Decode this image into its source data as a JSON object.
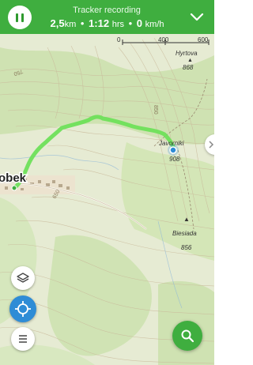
{
  "status_bar": {
    "title": "Tracker recording",
    "distance_value": "2,5",
    "distance_unit": "km",
    "duration_value": "1:12",
    "duration_unit": "hrs",
    "speed_value": "0",
    "speed_unit": "km/h",
    "separator": "•"
  },
  "scale": {
    "start_label": "0",
    "mid_label": "400",
    "end_label": "600"
  },
  "map_labels": {
    "place_left": "obek",
    "peak_javorniki_name": "Javorniki",
    "peak_javorniki_elev": "908",
    "peak_top_name": "Hyrtova",
    "peak_top_elev": "868",
    "peak_biesiada_name": "Biesiada",
    "peak_biesiada_elev": "856",
    "contour_850": "850",
    "contour_750": "750",
    "contour_650": "650"
  },
  "colors": {
    "accent": "#3fae3f",
    "track": "#6ee05a",
    "location": "#2e8cd6"
  },
  "icons": {
    "pause": "pause-icon",
    "collapse": "chevron-down-icon",
    "layers": "layers-icon",
    "location": "my-location-icon",
    "menu": "menu-icon",
    "search": "search-icon",
    "side": "chevron-right-icon"
  }
}
